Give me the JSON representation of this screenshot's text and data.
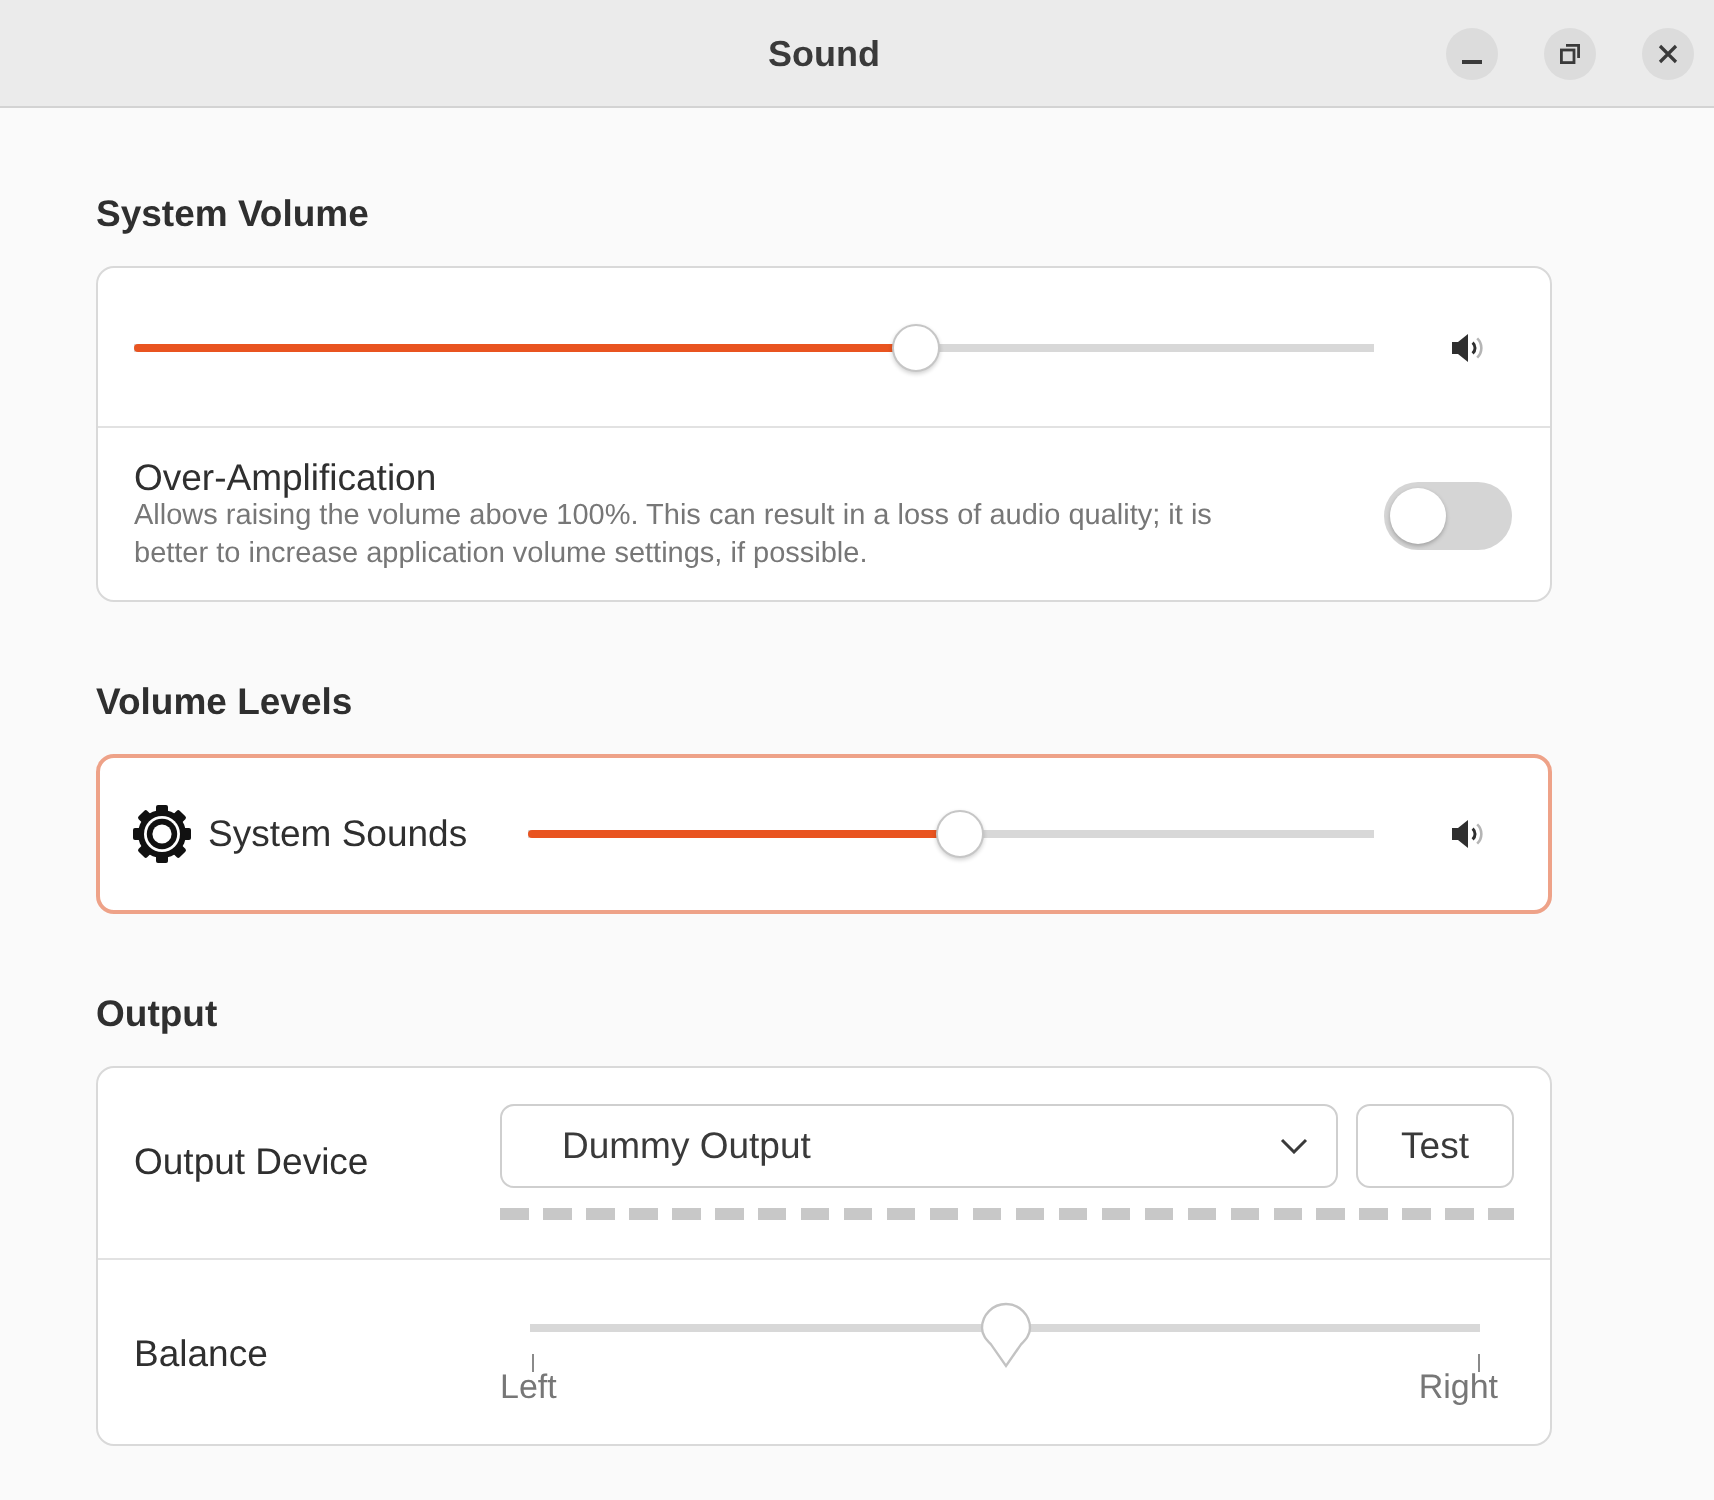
{
  "window": {
    "title": "Sound"
  },
  "system_volume": {
    "heading": "System Volume",
    "volume": {
      "level": 0.63
    },
    "over_amplification": {
      "title": "Over-Amplification",
      "description": "Allows raising the volume above 100%. This can result in a loss of audio quality; it is better to increase application volume settings, if possible.",
      "on": false
    }
  },
  "volume_levels": {
    "heading": "Volume Levels",
    "streams": [
      {
        "name": "System Sounds",
        "level": 0.51,
        "focused": true
      }
    ]
  },
  "output": {
    "heading": "Output",
    "device": {
      "label": "Output Device",
      "value": "Dummy Output",
      "button": "Test",
      "meter": {
        "level": 0
      }
    },
    "balance": {
      "label": "Balance",
      "level": 0.5,
      "left": "Left",
      "right": "Right"
    }
  }
}
